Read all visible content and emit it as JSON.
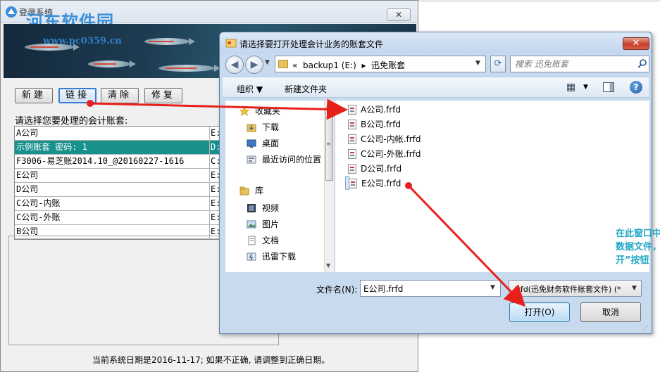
{
  "back_window": {
    "title": "登录系统",
    "close_label": "✕",
    "watermark": "河东软件园",
    "watermark_url": "www.pc0359.cn",
    "buttons": {
      "new": "新建",
      "link": "链接",
      "clear": "清除",
      "repair": "修复"
    },
    "prompt": "请选择您要处理的会计账套:",
    "accounts": [
      {
        "name": "A公司",
        "drive": "E:"
      },
      {
        "name": "示例账套  密码: 1",
        "drive": "D:"
      },
      {
        "name": "F3006-易芝账2014.10_@20160227-1616",
        "drive": "C:"
      },
      {
        "name": "E公司",
        "drive": "E:"
      },
      {
        "name": "D公司",
        "drive": "E:"
      },
      {
        "name": "C公司-内账",
        "drive": "E:"
      },
      {
        "name": "C公司-外账",
        "drive": "E:"
      },
      {
        "name": "B公司",
        "drive": "E:"
      }
    ],
    "selected_account_index": 1,
    "status": "当前系统日期是2016-11-17; 如果不正确, 请调整到正确日期。"
  },
  "open_dialog": {
    "title": "请选择要打开处理会计业务的账套文件",
    "close_label": "✕",
    "address": {
      "prefix": "«",
      "drive": "backup1 (E:)",
      "separator": "▸",
      "folder": "迅免账套"
    },
    "search_placeholder": "搜索 迅免账套",
    "toolbar": {
      "organize": "组织 ▼",
      "new_folder": "新建文件夹",
      "help": "?"
    },
    "nav_items": [
      {
        "label": "收藏夹",
        "icon": "star-icon",
        "group": true
      },
      {
        "label": "下载",
        "icon": "download-folder-icon",
        "group": false
      },
      {
        "label": "桌面",
        "icon": "desktop-icon",
        "group": false
      },
      {
        "label": "最近访问的位置",
        "icon": "recent-places-icon",
        "group": false
      },
      {
        "label": "库",
        "icon": "library-icon",
        "group": true
      },
      {
        "label": "视频",
        "icon": "video-library-icon",
        "group": false
      },
      {
        "label": "图片",
        "icon": "picture-library-icon",
        "group": false
      },
      {
        "label": "文档",
        "icon": "document-library-icon",
        "group": false
      },
      {
        "label": "迅雷下载",
        "icon": "thunder-download-icon",
        "group": false
      }
    ],
    "files": [
      {
        "name": "A公司.frfd"
      },
      {
        "name": "B公司.frfd"
      },
      {
        "name": "C公司-内帐.frfd"
      },
      {
        "name": "C公司-外账.frfd"
      },
      {
        "name": "D公司.frfd"
      },
      {
        "name": "E公司.frfd"
      }
    ],
    "selected_file_index": 5,
    "annotation": "在此窗口中找到要链接打开的帐套数据文件，然后点击下面的“打开”按钮",
    "filename_label": "文件名(N):",
    "filename_value": "E公司.frfd",
    "filetype_value": ".frfd(迅免财务软件账套文件) (*",
    "open_label": "打开(O)",
    "cancel_label": "取消"
  },
  "colors": {
    "selected_row": "#18908c",
    "annotation": "#23a8c4",
    "arrow": "#e8201c"
  }
}
